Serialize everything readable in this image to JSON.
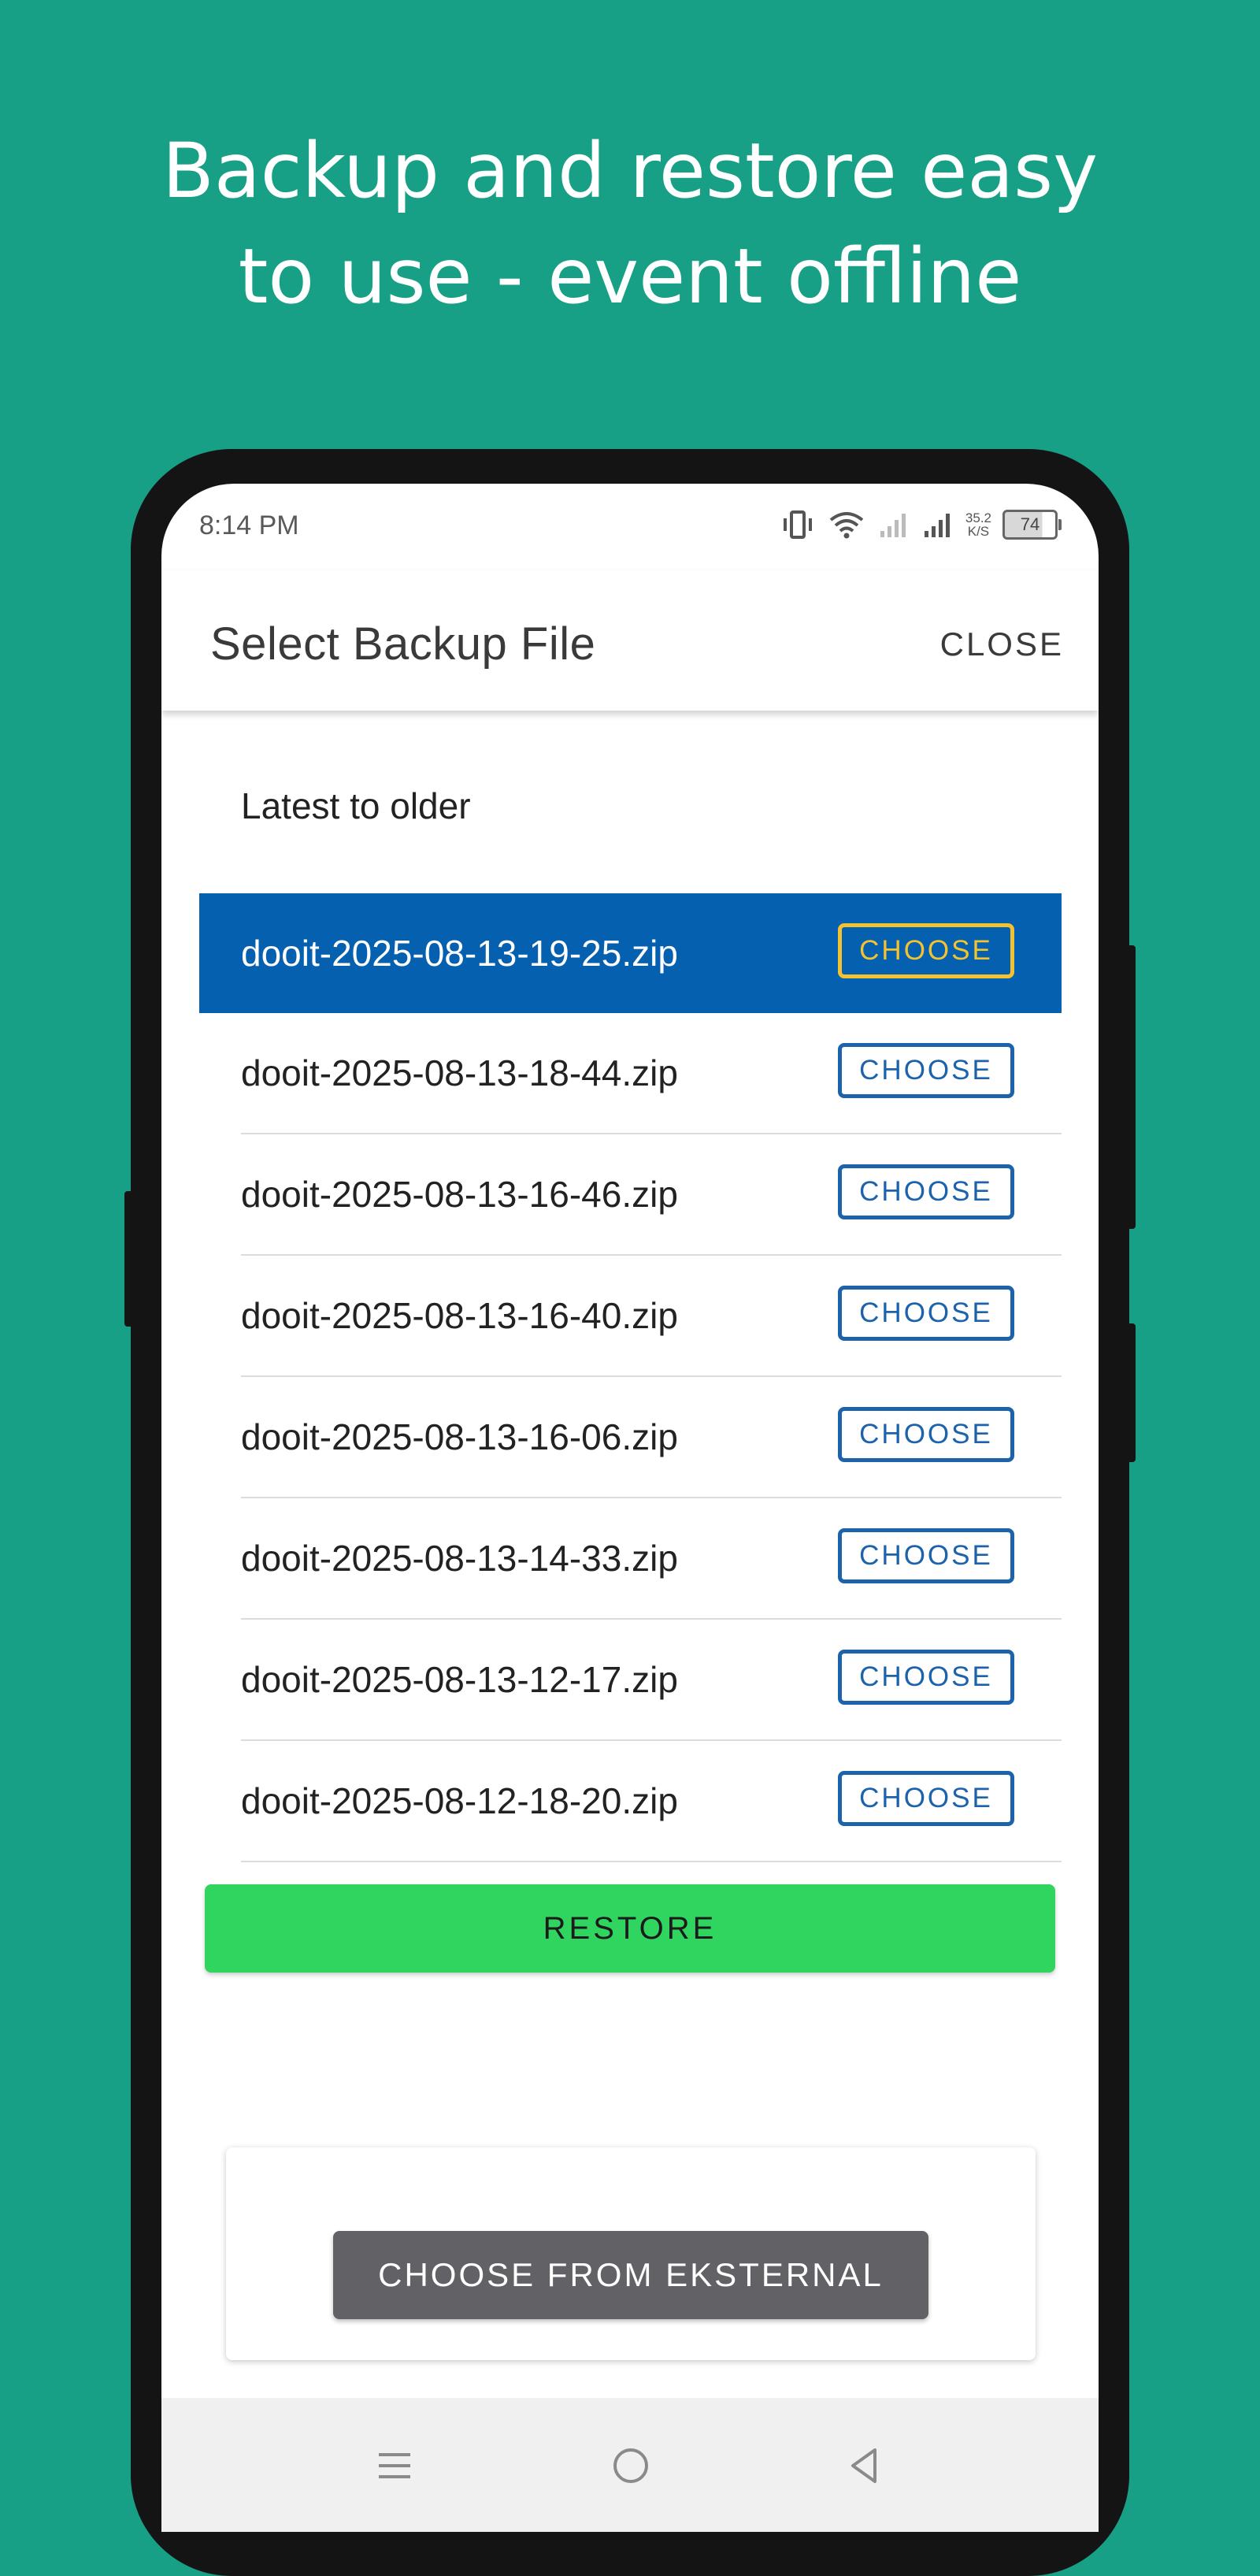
{
  "headline": {
    "line1": "Backup and restore easy",
    "line2": "to use - event offline"
  },
  "status_bar": {
    "time": "8:14 PM",
    "net_speed_value": "35.2",
    "net_speed_unit": "K/S",
    "battery": "74"
  },
  "app_bar": {
    "title": "Select Backup File",
    "close_label": "CLOSE"
  },
  "sort_label": "Latest to older",
  "backup_files": [
    {
      "name": "dooit-2025-08-13-19-25.zip",
      "action": "CHOOSE",
      "selected": true
    },
    {
      "name": "dooit-2025-08-13-18-44.zip",
      "action": "CHOOSE",
      "selected": false
    },
    {
      "name": "dooit-2025-08-13-16-46.zip",
      "action": "CHOOSE",
      "selected": false
    },
    {
      "name": "dooit-2025-08-13-16-40.zip",
      "action": "CHOOSE",
      "selected": false
    },
    {
      "name": "dooit-2025-08-13-16-06.zip",
      "action": "CHOOSE",
      "selected": false
    },
    {
      "name": "dooit-2025-08-13-14-33.zip",
      "action": "CHOOSE",
      "selected": false
    },
    {
      "name": "dooit-2025-08-13-12-17.zip",
      "action": "CHOOSE",
      "selected": false
    },
    {
      "name": "dooit-2025-08-12-18-20.zip",
      "action": "CHOOSE",
      "selected": false
    }
  ],
  "restore_label": "RESTORE",
  "external_label": "CHOOSE FROM EKSTERNAL",
  "nav_icons": [
    "menu-icon",
    "home-circle-icon",
    "back-triangle-icon"
  ],
  "colors": {
    "background": "#17a085",
    "selected_row": "#0660b0",
    "selected_accent": "#f2c230",
    "choose_border": "#1c63ab",
    "restore": "#2fd55e",
    "external_button": "#616166"
  }
}
